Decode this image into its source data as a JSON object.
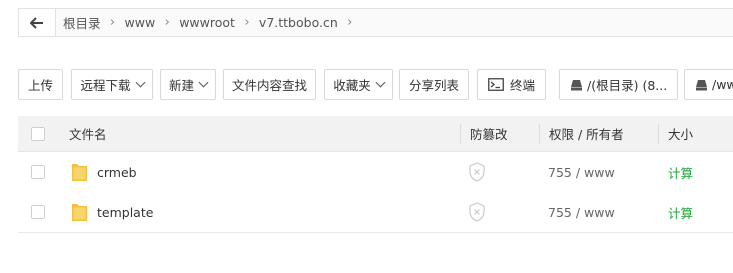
{
  "breadcrumb": {
    "items": [
      "根目录",
      "www",
      "wwwroot",
      "v7.ttbobo.cn"
    ]
  },
  "toolbar": {
    "upload": "上传",
    "remote_download": "远程下载",
    "new": "新建",
    "content_search": "文件内容查找",
    "favorites": "收藏夹",
    "share_list": "分享列表",
    "terminal": "终端",
    "disk1": "/(根目录) (8...",
    "disk2": "/ww"
  },
  "table": {
    "headers": {
      "name": "文件名",
      "tamper": "防篡改",
      "perm": "权限 / 所有者",
      "size": "大小"
    },
    "rows": [
      {
        "name": "crmeb",
        "perm": "755 / www",
        "size": "计算"
      },
      {
        "name": "template",
        "perm": "755 / www",
        "size": "计算"
      }
    ]
  },
  "colors": {
    "accent_green": "#20a53a",
    "folder_yellow": "#f5c141"
  }
}
